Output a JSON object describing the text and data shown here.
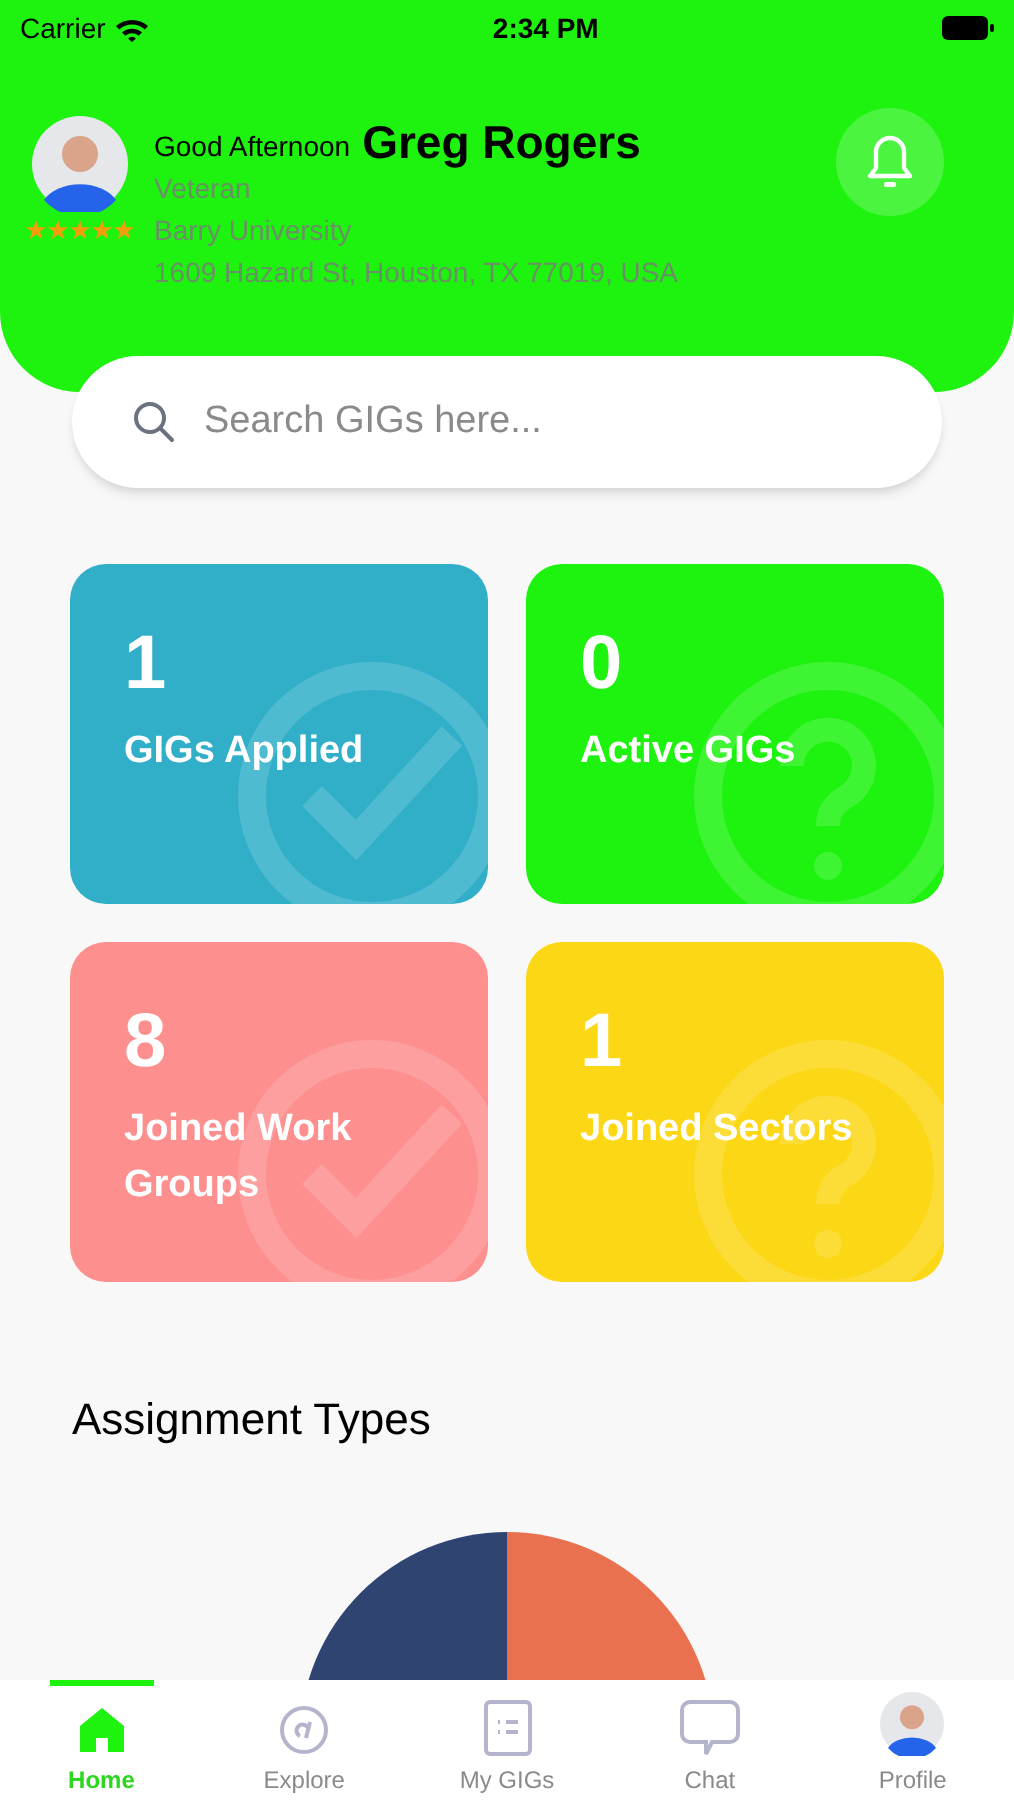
{
  "status_bar": {
    "carrier": "Carrier",
    "time": "2:34 PM"
  },
  "header": {
    "greeting": "Good Afternoon",
    "name": "Greg Rogers",
    "stars": 5,
    "details": [
      "Veteran",
      "Barry University",
      "1609 Hazard St, Houston, TX 77019, USA"
    ]
  },
  "search": {
    "placeholder": "Search GIGs here..."
  },
  "stats": [
    {
      "count": "1",
      "label": "GIGs Applied",
      "color": "#31afc8",
      "kind": "check"
    },
    {
      "count": "0",
      "label": "Active GIGs",
      "color": "#1ef20f",
      "kind": "question"
    },
    {
      "count": "8",
      "label": "Joined Work Groups",
      "color": "#fd8f8f",
      "kind": "check"
    },
    {
      "count": "1",
      "label": "Joined Sectors",
      "color": "#fcd716",
      "kind": "question"
    }
  ],
  "section_title": "Assignment Types",
  "tabs": [
    {
      "label": "Home",
      "selected": true,
      "kind": "home"
    },
    {
      "label": "Explore",
      "selected": false,
      "kind": "explore"
    },
    {
      "label": "My GIGs",
      "selected": false,
      "kind": "list"
    },
    {
      "label": "Chat",
      "selected": false,
      "kind": "chat"
    },
    {
      "label": "Profile",
      "selected": false,
      "kind": "avatar"
    }
  ]
}
